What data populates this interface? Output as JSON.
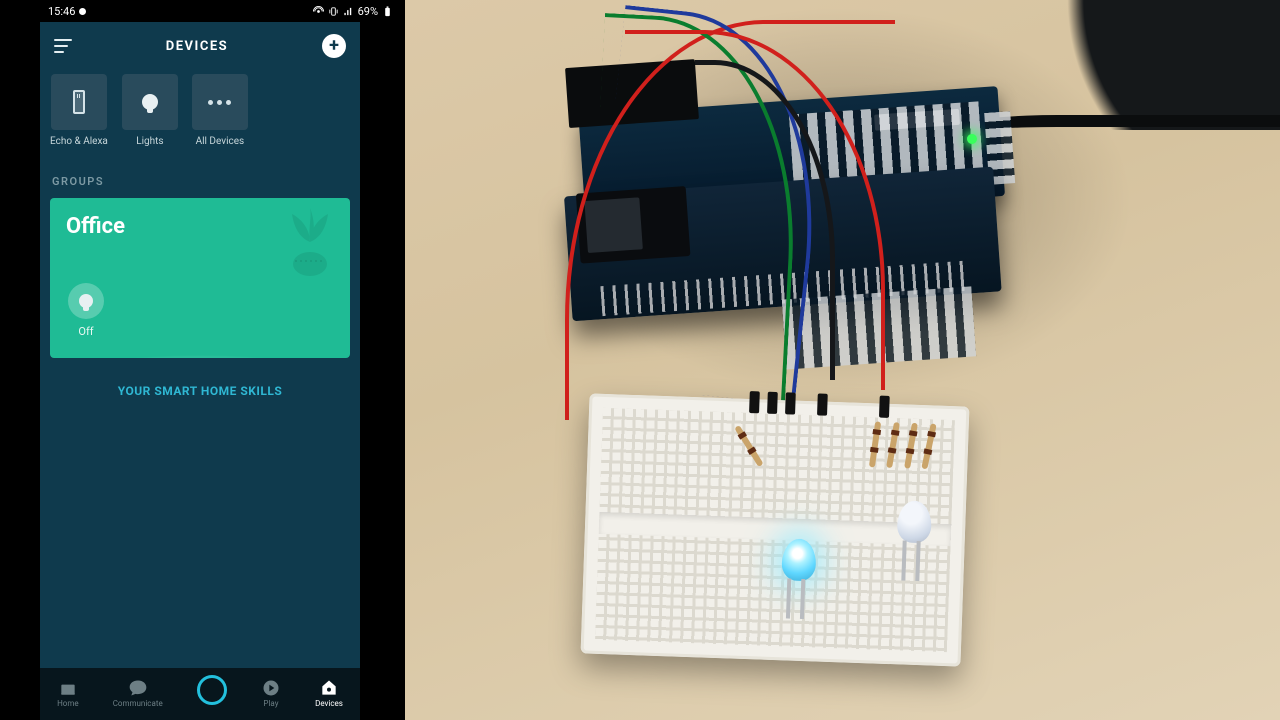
{
  "status": {
    "time": "15:46",
    "battery": "69%"
  },
  "header": {
    "title": "DEVICES"
  },
  "categories": [
    {
      "id": "echo",
      "label": "Echo & Alexa"
    },
    {
      "id": "lights",
      "label": "Lights"
    },
    {
      "id": "all",
      "label": "All Devices"
    }
  ],
  "groups": {
    "section_label": "GROUPS",
    "items": [
      {
        "name": "Office",
        "toggle_state": "Off"
      }
    ]
  },
  "skills_link": "YOUR SMART HOME SKILLS",
  "tabs": [
    {
      "id": "home",
      "label": "Home",
      "active": false
    },
    {
      "id": "communicate",
      "label": "Communicate",
      "active": false
    },
    {
      "id": "alexa",
      "label": "",
      "active": false
    },
    {
      "id": "play",
      "label": "Play",
      "active": false
    },
    {
      "id": "devices",
      "label": "Devices",
      "active": true
    }
  ],
  "colors": {
    "app_bg": "#0f3a4d",
    "tile": "#294b5c",
    "group": "#1fbb95",
    "accent": "#2fb7d3"
  }
}
